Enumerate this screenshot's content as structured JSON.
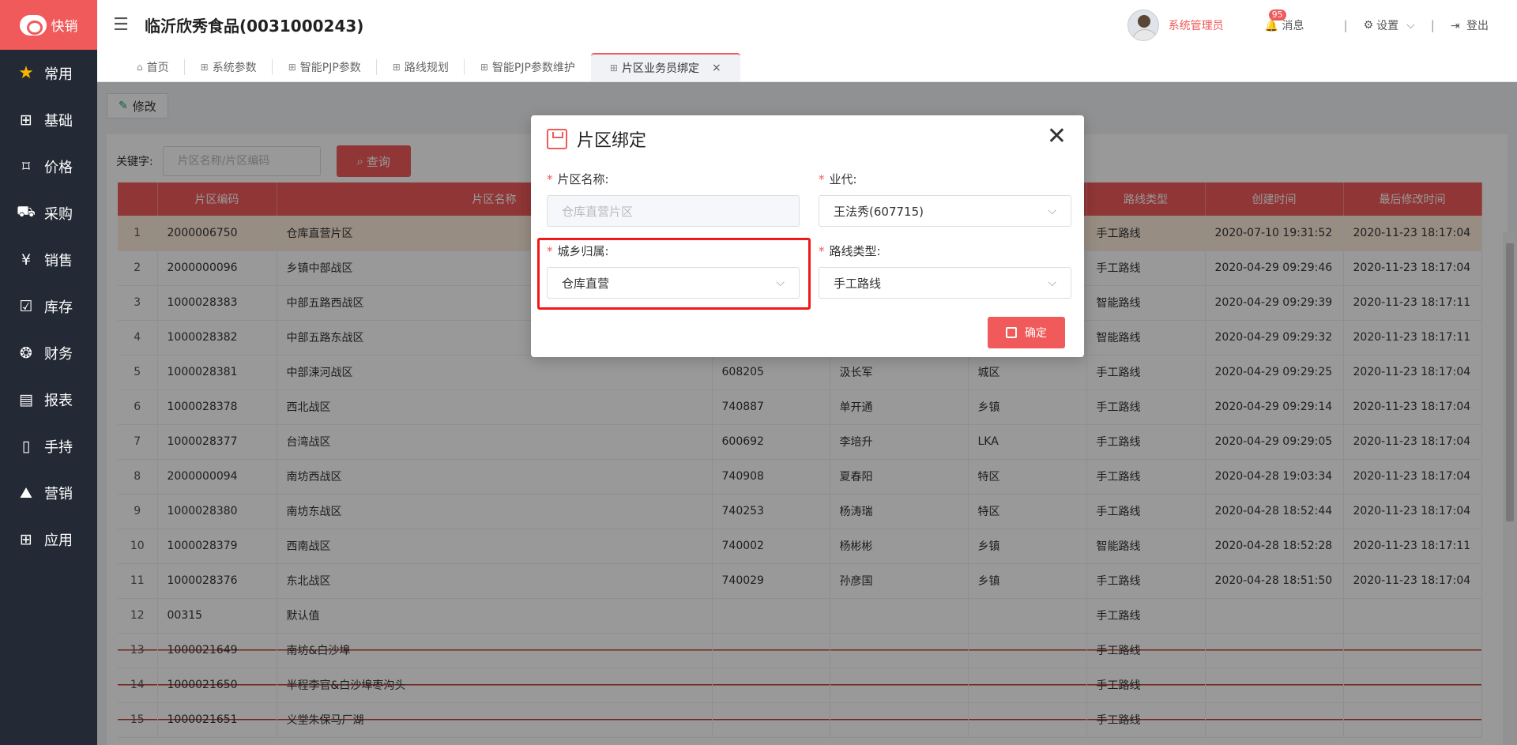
{
  "app": {
    "logo_text": "快销",
    "company": "临沂欣秀食品(0031000243)"
  },
  "header": {
    "user": "系统管理员",
    "messages_label": "消息",
    "message_count": "95",
    "settings_label": "设置",
    "logout_label": "登出",
    "separator": "|"
  },
  "sidebar": {
    "items": [
      {
        "label": "常用",
        "icon": "star-icon"
      },
      {
        "label": "基础",
        "icon": "grid-icon"
      },
      {
        "label": "价格",
        "icon": "tag-icon"
      },
      {
        "label": "采购",
        "icon": "cart-icon"
      },
      {
        "label": "销售",
        "icon": "yen-icon"
      },
      {
        "label": "库存",
        "icon": "inventory-icon"
      },
      {
        "label": "财务",
        "icon": "moneybag-icon"
      },
      {
        "label": "报表",
        "icon": "report-icon"
      },
      {
        "label": "手持",
        "icon": "handheld-icon"
      },
      {
        "label": "营销",
        "icon": "marketing-icon"
      },
      {
        "label": "应用",
        "icon": "apps-icon"
      }
    ]
  },
  "tabs": [
    {
      "label": "首页",
      "icon": "home-icon"
    },
    {
      "label": "系统参数",
      "icon": "grid-icon"
    },
    {
      "label": "智能PJP参数",
      "icon": "grid-icon"
    },
    {
      "label": "路线规划",
      "icon": "grid-icon"
    },
    {
      "label": "智能PJP参数维护",
      "icon": "grid-icon"
    },
    {
      "label": "片区业务员绑定",
      "icon": "grid-icon",
      "active": true
    }
  ],
  "toolbar": {
    "edit_label": "修改"
  },
  "search": {
    "label": "关键字:",
    "placeholder": "片区名称/片区编码",
    "button_label": "查询"
  },
  "table": {
    "columns": [
      "",
      "片区编码",
      "片区名称",
      "",
      "",
      "",
      "路线类型",
      "创建时间",
      "最后修改时间"
    ],
    "rows": [
      [
        "1",
        "2000006750",
        "仓库直营片区",
        "",
        "",
        "",
        "手工路线",
        "2020-07-10 19:31:52",
        "2020-11-23 18:17:04"
      ],
      [
        "2",
        "2000000096",
        "乡镇中部战区",
        "",
        "",
        "",
        "手工路线",
        "2020-04-29 09:29:46",
        "2020-11-23 18:17:04"
      ],
      [
        "3",
        "1000028383",
        "中部五路西战区",
        "",
        "",
        "",
        "智能路线",
        "2020-04-29 09:29:39",
        "2020-11-23 18:17:11"
      ],
      [
        "4",
        "1000028382",
        "中部五路东战区",
        "",
        "",
        "",
        "智能路线",
        "2020-04-29 09:29:32",
        "2020-11-23 18:17:11"
      ],
      [
        "5",
        "1000028381",
        "中部涑河战区",
        "608205",
        "汲长军",
        "城区",
        "手工路线",
        "2020-04-29 09:29:25",
        "2020-11-23 18:17:04"
      ],
      [
        "6",
        "1000028378",
        "西北战区",
        "740887",
        "单开通",
        "乡镇",
        "手工路线",
        "2020-04-29 09:29:14",
        "2020-11-23 18:17:04"
      ],
      [
        "7",
        "1000028377",
        "台湾战区",
        "600692",
        "李培升",
        "LKA",
        "手工路线",
        "2020-04-29 09:29:05",
        "2020-11-23 18:17:04"
      ],
      [
        "8",
        "2000000094",
        "南坊西战区",
        "740908",
        "夏春阳",
        "特区",
        "手工路线",
        "2020-04-28 19:03:34",
        "2020-11-23 18:17:04"
      ],
      [
        "9",
        "1000028380",
        "南坊东战区",
        "740253",
        "杨涛瑞",
        "特区",
        "手工路线",
        "2020-04-28 18:52:44",
        "2020-11-23 18:17:04"
      ],
      [
        "10",
        "1000028379",
        "西南战区",
        "740002",
        "杨彬彬",
        "乡镇",
        "智能路线",
        "2020-04-28 18:52:28",
        "2020-11-23 18:17:11"
      ],
      [
        "11",
        "1000028376",
        "东北战区",
        "740029",
        "孙彦国",
        "乡镇",
        "手工路线",
        "2020-04-28 18:51:50",
        "2020-11-23 18:17:04"
      ],
      [
        "12",
        "00315",
        "默认值",
        "",
        "",
        "",
        "手工路线",
        "",
        ""
      ],
      [
        "13",
        "1000021649",
        "南坊&白沙埠",
        "",
        "",
        "",
        "手工路线",
        "",
        ""
      ],
      [
        "14",
        "1000021650",
        "半程李官&白沙埠枣沟头",
        "",
        "",
        "",
        "手工路线",
        "",
        ""
      ],
      [
        "15",
        "1000021651",
        "义堂朱保马厂湖",
        "",
        "",
        "",
        "手工路线",
        "",
        ""
      ]
    ],
    "selected_row": 1,
    "struck_rows": [
      13,
      14,
      15
    ]
  },
  "dialog": {
    "title": "片区绑定",
    "fields": {
      "name": {
        "label": "片区名称:",
        "value": "仓库直营片区",
        "disabled": true
      },
      "agent": {
        "label": "业代:",
        "value": "王法秀(607715)"
      },
      "urban": {
        "label": "城乡归属:",
        "value": "仓库直营"
      },
      "route": {
        "label": "路线类型:",
        "value": "手工路线"
      }
    },
    "required_mark": "*",
    "confirm_label": "确定"
  },
  "colors": {
    "accent": "#f05a5a",
    "sidebar": "#232a35",
    "highlight": "#f01818",
    "selected_row": "#fdebd9"
  }
}
